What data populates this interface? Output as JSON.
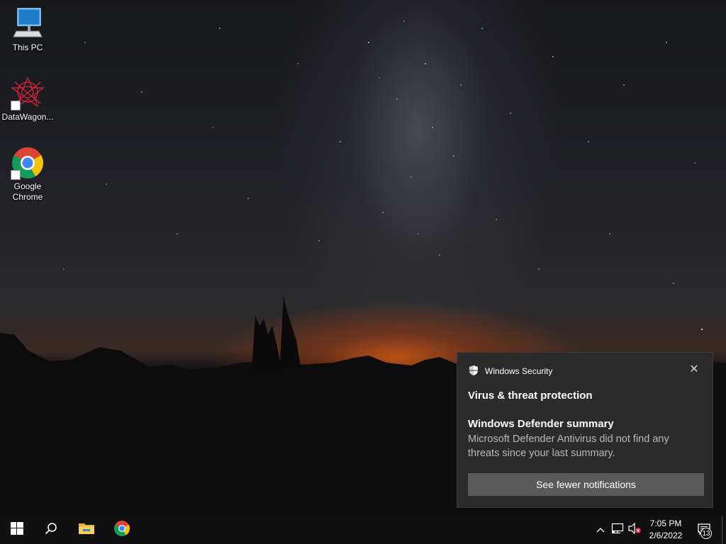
{
  "desktop": {
    "icons": [
      {
        "label": "This PC",
        "icon": "computer-icon"
      },
      {
        "label": "DataWagon...",
        "icon": "datawagon-icon"
      },
      {
        "label": "Google Chrome",
        "icon": "chrome-icon"
      }
    ]
  },
  "notification": {
    "app_name": "Windows Security",
    "app_icon": "shield-icon",
    "close_glyph": "✕",
    "headline": "Virus & threat protection",
    "subtitle": "Windows Defender summary",
    "body": "Microsoft Defender Antivirus did not find any threats since your last summary.",
    "action_label": "See fewer notifications"
  },
  "taskbar": {
    "pinned": [
      "start-icon",
      "search-icon",
      "file-explorer-icon",
      "chrome-icon"
    ],
    "tray": [
      "chevron-up-icon",
      "network-icon",
      "volume-muted-icon"
    ],
    "time": "7:05 PM",
    "date": "2/6/2022",
    "notification_count": "13"
  },
  "colors": {
    "toast_bg": "#2b2b2b",
    "toast_button": "#5a5a5a",
    "taskbar_bg": "#101010"
  }
}
